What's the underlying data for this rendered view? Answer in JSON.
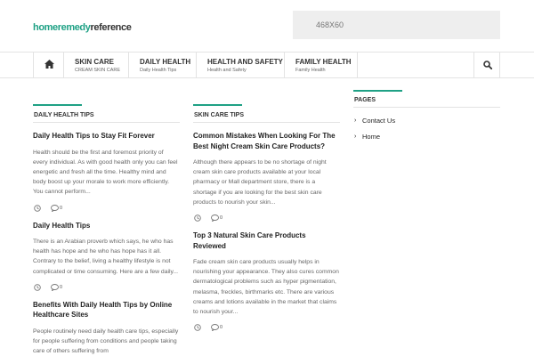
{
  "site": {
    "logo_part1": "homeremedy",
    "logo_part2": "reference",
    "ad_label": "468X60"
  },
  "nav": {
    "home_icon": "home-icon",
    "search_icon": "search-icon",
    "items": [
      {
        "title": "SKIN CARE",
        "subtitle": "CREAM SKIN CARE"
      },
      {
        "title": "DAILY HEALTH",
        "subtitle": "Daily Health Tips"
      },
      {
        "title": "HEALTH AND SAFETY",
        "subtitle": "Health and Safety"
      },
      {
        "title": "FAMILY HEALTH",
        "subtitle": "Family Health"
      }
    ]
  },
  "columns": [
    {
      "heading": "DAILY HEALTH TIPS",
      "posts": [
        {
          "title": "Daily Health Tips to Stay Fit Forever",
          "excerpt": "Health should be the first and foremost priority of every individual. As with good health only you can feel energetic and fresh all the time. Healthy mind and body boost up your morale to work more efficiently. You cannot perform...",
          "comments": "0"
        },
        {
          "title": "Daily Health Tips",
          "excerpt": "There is an Arabian proverb which says, he who has health has hope and he who has hope has it all. Contrary to the belief, living a healthy lifestyle is not complicated or time consuming. Here are a few daily...",
          "comments": "0"
        },
        {
          "title": "Benefits With Daily Health Tips by Online Healthcare Sites",
          "excerpt": "People routinely need daily health care tips, especially for people suffering from conditions and people taking care of others suffering from"
        }
      ]
    },
    {
      "heading": "SKIN CARE TIPS",
      "posts": [
        {
          "title": "Common Mistakes When Looking For The Best Night Cream Skin Care Products?",
          "excerpt": "Although there appears to be no shortage of night cream skin care products available at your local pharmacy or Mall department store, there is a shortage if you are looking for the best skin care products to nourish your skin...",
          "comments": "0"
        },
        {
          "title": "Top 3 Natural Skin Care Products Reviewed",
          "excerpt": "Fade cream skin care products usually helps in nourishing your appearance. They also cures common dermatological problems such as hyper pigmentation, melasma, freckles, birthmarks etc. There are various creams and lotions available in the market that claims to nourish your...",
          "comments": "0"
        }
      ]
    }
  ],
  "sidebar": {
    "heading": "PAGES",
    "links": [
      "Contact Us",
      "Home"
    ]
  }
}
